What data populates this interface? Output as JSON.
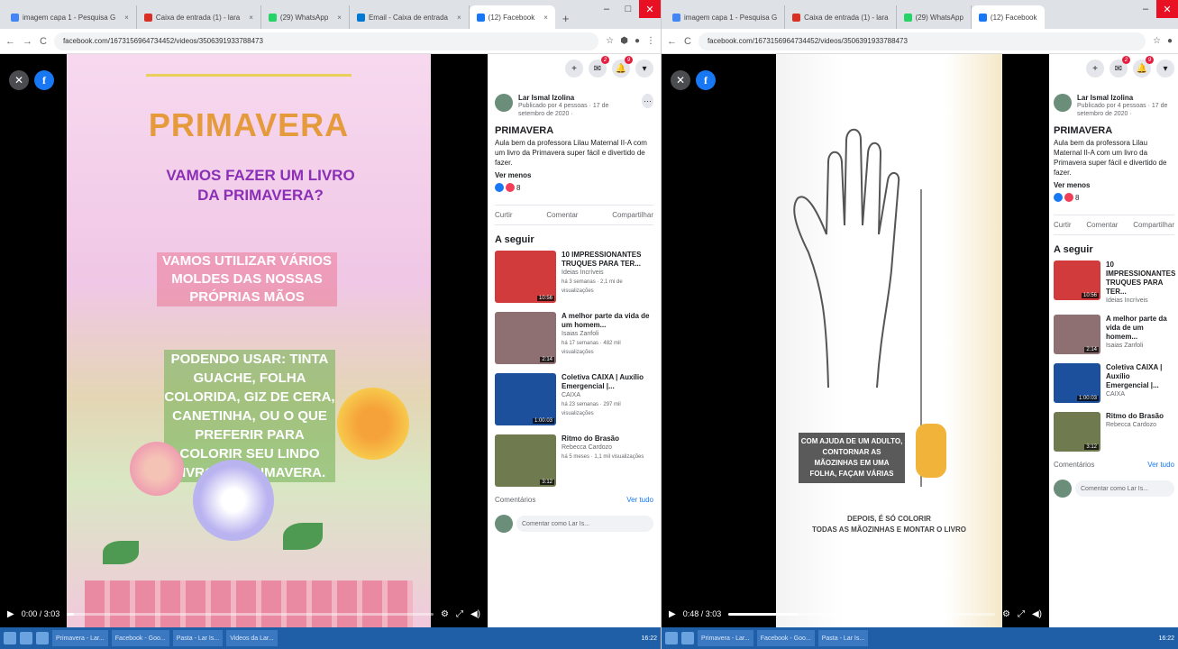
{
  "browser": {
    "tabs": [
      {
        "label": "imagem capa 1 - Pesquisa G",
        "color": "#4285f4"
      },
      {
        "label": "Caixa de entrada (1) - lara",
        "color": "#d93025"
      },
      {
        "label": "(29) WhatsApp",
        "color": "#25d366"
      },
      {
        "label": "Email - Caixa de entrada",
        "color": "#0078d4"
      },
      {
        "label": "(12) Facebook",
        "color": "#1877f2"
      }
    ],
    "new_tab": "+",
    "url": "facebook.com/1673156964734452/videos/3506391933788473",
    "nav_back": "←",
    "nav_forward": "→",
    "nav_reload": "C",
    "win_min": "–",
    "win_max": "□",
    "win_close": "✕"
  },
  "overlay": {
    "close": "✕",
    "logo": "f"
  },
  "left_video": {
    "title": "PRIMAVERA",
    "subtitle": "VAMOS FAZER UM LIVRO DA PRIMAVERA?",
    "box1": "VAMOS UTILIZAR VÁRIOS MOLDES DAS NOSSAS PRÓPRIAS MÃOS",
    "box2": "PODENDO USAR: TINTA GUACHE, FOLHA COLORIDA, GIZ DE CERA, CANETINHA, OU O QUE PREFERIR PARA COLORIR SEU LINDO LIVRO DA PRIMAVERA.",
    "time": "0:00 / 3:03",
    "progress": 0.02
  },
  "right_video": {
    "box": "COM AJUDA DE UM ADULTO, CONTORNAR AS MÃOZINHAS EM UMA FOLHA, FAÇAM VÁRIAS",
    "bottom_line1": "DEPOIS, É SÓ COLORIR",
    "bottom_line2": "TODAS AS MÃOZINHAS E MONTAR O LIVRO",
    "time": "0:48 / 3:03",
    "progress": 0.26
  },
  "controls": {
    "play": "▶",
    "settings": "⚙",
    "fullscreen": "⤢",
    "volume": "◀)"
  },
  "post": {
    "author": "Lar Ismal Izolina",
    "meta": "Publicado por 4 pessoas · 17 de setembro de 2020 ·",
    "title": "PRIMAVERA",
    "description": "Aula bem da professora Lilau Maternal II-A com um livro da Primavera super fácil e divertido de fazer.",
    "see_less": "Ver menos",
    "reaction_count": "8",
    "like": "Curtir",
    "comment": "Comentar",
    "share": "Compartilhar"
  },
  "up_next_label": "A seguir",
  "up_next": [
    {
      "title": "10 IMPRESSIONANTES TRUQUES PARA TER...",
      "channel": "Ideias Incríveis",
      "stats": "há 3 semanas · 2,1 mi de visualizações",
      "duration": "10:56",
      "thumb": "#d23b3b"
    },
    {
      "title": "A melhor parte da vida de um homem...",
      "channel": "Isaias Zanfoli",
      "stats": "há 17 semanas · 482 mil visualizações",
      "duration": "2:14",
      "thumb": "#8e6f72"
    },
    {
      "title": "Coletiva CAIXA | Auxílio Emergencial |...",
      "channel": "CAIXA",
      "stats": "há 23 semanas · 297 mil visualizações",
      "duration": "1:00:03",
      "thumb": "#1c4f9c"
    },
    {
      "title": "Ritmo do Brasão",
      "channel": "Rebecca Cardozo",
      "stats": "há 5 meses · 1,1 mil visualizações",
      "duration": "3:12",
      "thumb": "#6f7a4f"
    }
  ],
  "comments": {
    "label": "Comentários",
    "link": "Ver tudo",
    "placeholder": "Comentar como Lar Is..."
  },
  "taskbar": {
    "items": [
      "Primavera - Lar...",
      "Facebook - Goo...",
      "Pasta - Lar Is...",
      "Videos da Lar..."
    ],
    "clock": "16:22"
  }
}
